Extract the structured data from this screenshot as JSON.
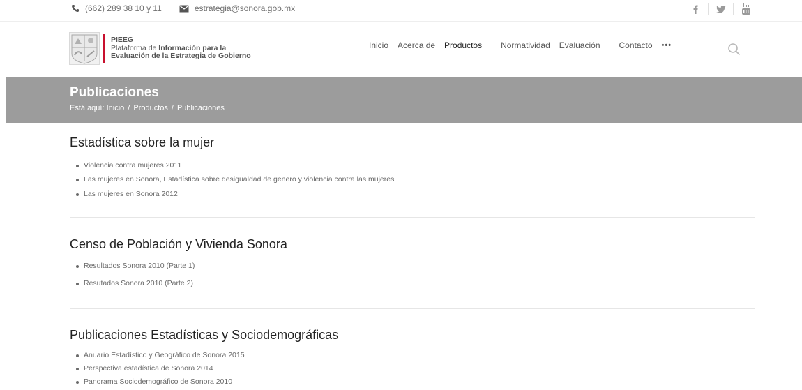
{
  "topbar": {
    "phone": "(662) 289 38 10 y 11",
    "email": "estrategia@sonora.gob.mx",
    "social": [
      "facebook-icon",
      "twitter-icon",
      "youtube-icon"
    ]
  },
  "logo": {
    "acronym": "PIEEG",
    "line1_normal": "Plataforma de ",
    "line1_bold": "Información para la",
    "line2": "Evaluación de la Estrategia de Gobierno"
  },
  "nav": {
    "items": [
      "Inicio",
      "Acerca de",
      "Productos",
      "Normatividad",
      "Evaluación",
      "Contacto",
      "•••"
    ]
  },
  "page": {
    "title": "Publicaciones",
    "breadcrumb_prefix": "Está aquí:",
    "breadcrumb": [
      "Inicio",
      "Productos",
      "Publicaciones"
    ],
    "separator": "/"
  },
  "sections": [
    {
      "heading": "Estadística sobre la mujer",
      "items": [
        "Violencia contra mujeres 2011",
        "Las mujeres en Sonora, Estadística sobre desigualdad de genero y violencia contra las mujeres",
        "Las mujeres en Sonora 2012"
      ]
    },
    {
      "heading": "Censo de Población y Vivienda Sonora",
      "items": [
        "Resultados Sonora 2010 (Parte 1)",
        "Resutados Sonora 2010 (Parte 2)"
      ]
    },
    {
      "heading": "Publicaciones Estadísticas y Sociodemográficas",
      "items": [
        "Anuario Estadístico y Geográfico de Sonora 2015",
        "Perspectiva estadística de Sonora 2014",
        "Panorama Sociodemográfico de Sonora 2010"
      ]
    }
  ],
  "colors": {
    "band": "#9c9c9c",
    "logo_red": "#c8102e"
  }
}
